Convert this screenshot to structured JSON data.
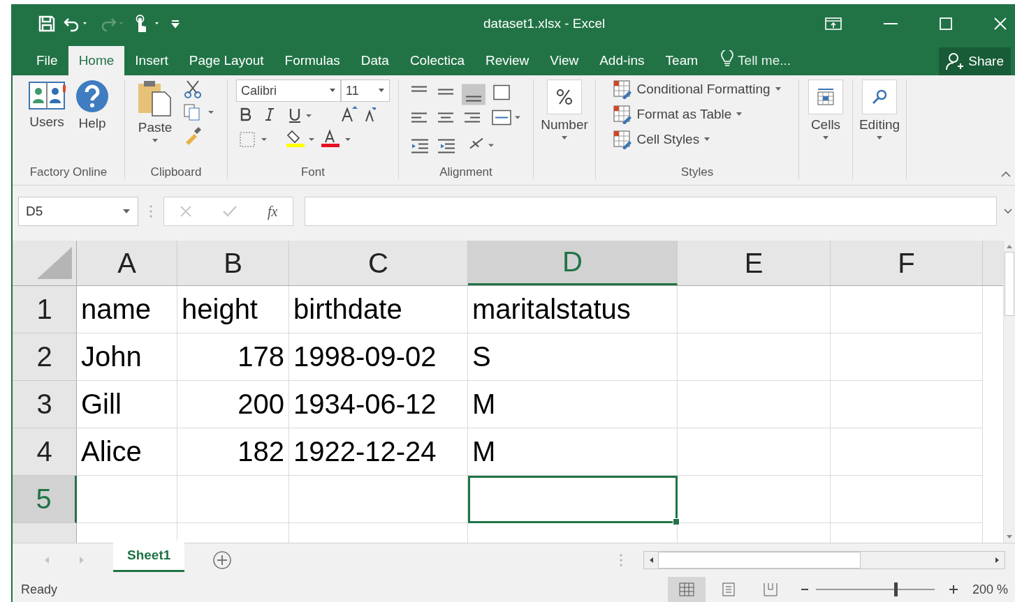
{
  "window": {
    "title": "dataset1.xlsx - Excel"
  },
  "tabs": [
    {
      "label": "File",
      "selected": false
    },
    {
      "label": "Home",
      "selected": true
    },
    {
      "label": "Insert",
      "selected": false
    },
    {
      "label": "Page Layout",
      "selected": false
    },
    {
      "label": "Formulas",
      "selected": false
    },
    {
      "label": "Data",
      "selected": false
    },
    {
      "label": "Colectica",
      "selected": false
    },
    {
      "label": "Review",
      "selected": false
    },
    {
      "label": "View",
      "selected": false
    },
    {
      "label": "Add-ins",
      "selected": false
    },
    {
      "label": "Team",
      "selected": false
    }
  ],
  "tell_me": {
    "placeholder": "Tell me..."
  },
  "share": {
    "label": "Share"
  },
  "ribbon": {
    "factory_online": {
      "label": "Factory Online",
      "buttons": [
        "Users",
        "Help"
      ]
    },
    "clipboard": {
      "label": "Clipboard",
      "paste": "Paste"
    },
    "font": {
      "label": "Font",
      "family": "Calibri",
      "size": "11"
    },
    "alignment": {
      "label": "Alignment"
    },
    "number": {
      "button": "Number"
    },
    "styles": {
      "label": "Styles",
      "buttons": [
        "Conditional Formatting",
        "Format as Table",
        "Cell Styles"
      ]
    },
    "cells": {
      "button": "Cells"
    },
    "editing": {
      "button": "Editing"
    }
  },
  "formula_bar": {
    "name_box": "D5",
    "fx": "fx"
  },
  "sheet": {
    "columns": [
      {
        "label": "A",
        "selected": false
      },
      {
        "label": "B",
        "selected": false
      },
      {
        "label": "C",
        "selected": false
      },
      {
        "label": "D",
        "selected": true
      },
      {
        "label": "E",
        "selected": false
      },
      {
        "label": "F",
        "selected": false
      }
    ],
    "rows": [
      {
        "label": "1",
        "selected": false,
        "cells": [
          {
            "text": "name",
            "kind": "text"
          },
          {
            "text": "height",
            "kind": "text"
          },
          {
            "text": "birthdate",
            "kind": "text"
          },
          {
            "text": "maritalstatus",
            "kind": "text"
          }
        ]
      },
      {
        "label": "2",
        "selected": false,
        "cells": [
          {
            "text": "John",
            "kind": "text"
          },
          {
            "text": "178",
            "kind": "number"
          },
          {
            "text": "1998-09-02",
            "kind": "text"
          },
          {
            "text": "S",
            "kind": "text"
          }
        ]
      },
      {
        "label": "3",
        "selected": false,
        "cells": [
          {
            "text": "Gill",
            "kind": "text"
          },
          {
            "text": "200",
            "kind": "number"
          },
          {
            "text": "1934-06-12",
            "kind": "text"
          },
          {
            "text": "M",
            "kind": "text"
          }
        ]
      },
      {
        "label": "4",
        "selected": false,
        "cells": [
          {
            "text": "Alice",
            "kind": "text"
          },
          {
            "text": "182",
            "kind": "number"
          },
          {
            "text": "1922-12-24",
            "kind": "text"
          },
          {
            "text": "M",
            "kind": "text"
          }
        ]
      },
      {
        "label": "5",
        "selected": true,
        "cells": []
      }
    ]
  },
  "sheet_tabs": [
    {
      "label": "Sheet1",
      "selected": true
    }
  ],
  "status_bar": {
    "text": "Ready",
    "zoom": "200 %",
    "zoom_slider": {
      "level": 0.66
    }
  }
}
